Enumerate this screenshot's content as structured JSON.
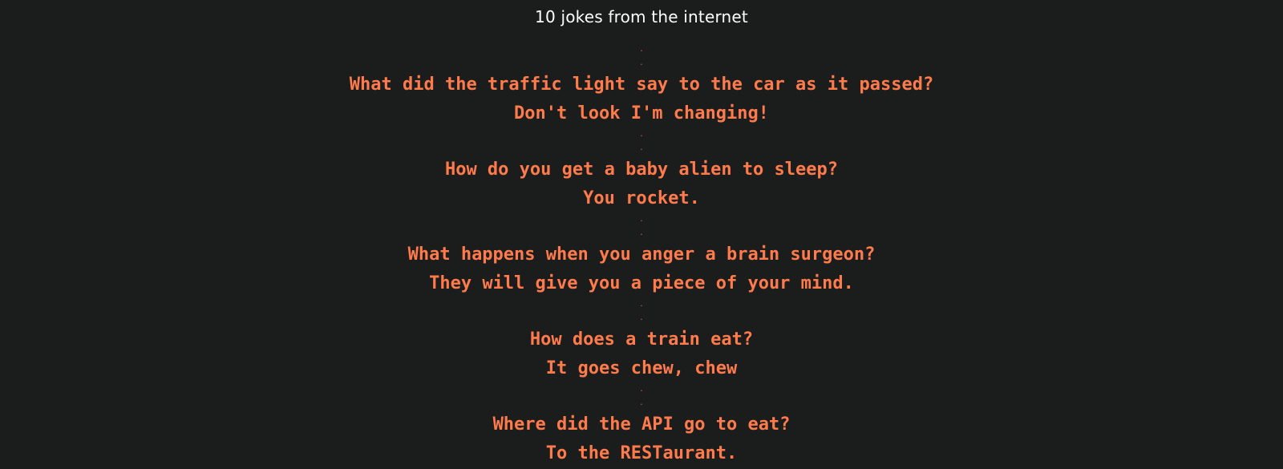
{
  "page": {
    "title": "10 jokes from the internet"
  },
  "separator": ".",
  "jokes": [
    {
      "question": "What did the traffic light say to the car as it passed?",
      "answer": "Don't look I'm changing!"
    },
    {
      "question": "How do you get a baby alien to sleep?",
      "answer": "You rocket."
    },
    {
      "question": "What happens when you anger a brain surgeon?",
      "answer": "They will give you a piece of your mind."
    },
    {
      "question": "How does a train eat?",
      "answer": "It goes chew, chew"
    },
    {
      "question": "Where did the API go to eat?",
      "answer": "To the RESTaurant."
    }
  ],
  "colors": {
    "background": "#1b1c1c",
    "title": "#ffffff",
    "joke_text": "#ff7b4b"
  }
}
